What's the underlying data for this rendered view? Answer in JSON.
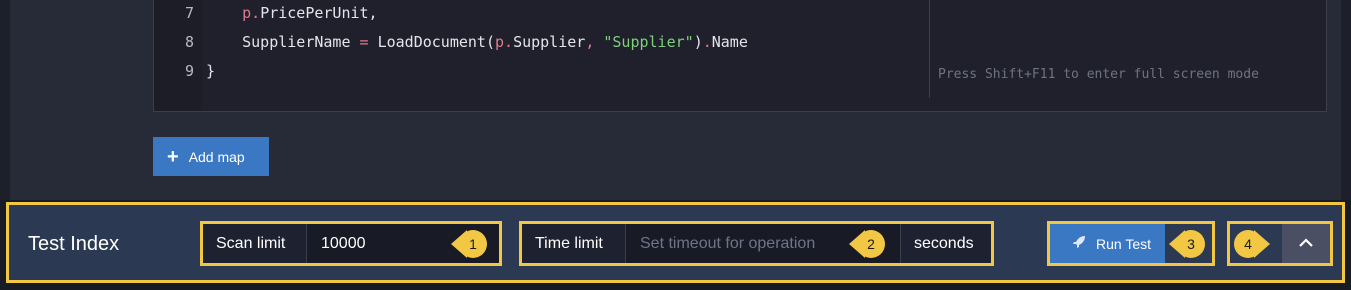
{
  "editor": {
    "lines": [
      {
        "num": "7",
        "indent": "    ",
        "p": "p",
        "dot": ".",
        "text": "PricePerUnit,"
      },
      {
        "num": "8",
        "indent": "    ",
        "name": "SupplierName",
        "eq": " = ",
        "fn": "LoadDocument(",
        "p": "p",
        "dot": ".",
        "arg": "Supplier",
        "comma": ", ",
        "str": "\"Supplier\"",
        "close": ")",
        "dot2": ".",
        "prop": "Name"
      },
      {
        "num": "9",
        "text": "}"
      }
    ],
    "hint": "Press Shift+F11 to enter full screen mode"
  },
  "add_map": {
    "label": "Add map",
    "icon": "plus-icon"
  },
  "test_bar": {
    "title": "Test Index",
    "scan_limit": {
      "label": "Scan limit",
      "value": "10000"
    },
    "time_limit": {
      "label": "Time limit",
      "placeholder": "Set timeout for operation",
      "unit": "seconds"
    },
    "run_test": {
      "label": "Run Test",
      "icon": "rocket-icon"
    },
    "collapse": {
      "icon": "chevron-up-icon"
    },
    "callouts": [
      "1",
      "2",
      "3",
      "4"
    ],
    "accent_color": "#f2c744"
  }
}
